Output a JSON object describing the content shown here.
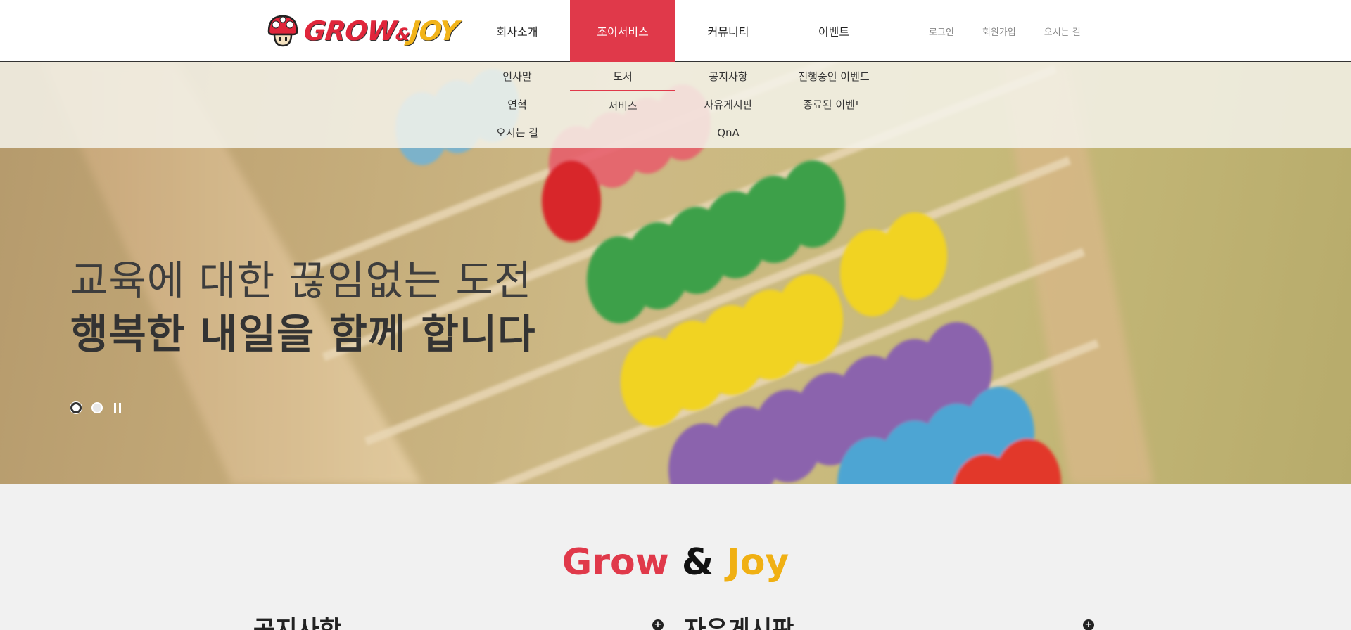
{
  "logo": {
    "grow": "GROW",
    "amp": "&",
    "joy": "JOY",
    "icon": "mushroom-icon"
  },
  "gnb": [
    {
      "label": "회사소개",
      "active": false
    },
    {
      "label": "조이서비스",
      "active": true
    },
    {
      "label": "커뮤니티",
      "active": false
    },
    {
      "label": "이벤트",
      "active": false
    }
  ],
  "submenu": [
    [
      "인사말",
      "연혁",
      "오시는 길"
    ],
    [
      "도서",
      "서비스"
    ],
    [
      "공지사항",
      "자유게시판",
      "QnA"
    ],
    [
      "진행중인 이벤트",
      "종료된 이벤트"
    ]
  ],
  "util": {
    "login": "로그인",
    "signup": "회원가입",
    "directions": "오시는 길"
  },
  "hero": {
    "line1": "교육에 대한 끊임없는 도전",
    "line2": "행복한 내일을 함께 합니다",
    "slides_total": 2,
    "slide_active": 1
  },
  "brand": {
    "grow": "Grow",
    "amp": "&",
    "joy": "Joy"
  },
  "boards": {
    "notice_title": "공지사항",
    "free_title": "자유게시판",
    "more_symbol": "+"
  },
  "colors": {
    "accent_red": "#e0394a",
    "accent_yellow": "#f0b013"
  }
}
